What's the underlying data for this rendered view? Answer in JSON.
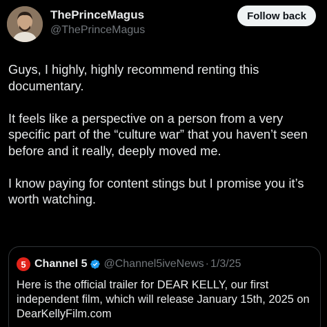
{
  "author": {
    "display_name": "ThePrinceMagus",
    "handle": "@ThePrinceMagus",
    "avatar_icon": "user-avatar"
  },
  "follow_button": {
    "label": "Follow back"
  },
  "post": {
    "paragraphs": [
      "Guys, I highly, highly recommend renting this documentary.",
      "It feels like a perspective on a person from a very specific part of the “culture war” that you haven’t seen before and it really, deeply moved me.",
      "I know paying for content stings but I promise you it’s worth watching."
    ]
  },
  "quote": {
    "logo_text": "5",
    "logo_color": "#e2231a",
    "display_name": "Channel 5",
    "verified_color": "#1d9bf0",
    "handle": "@Channel5iveNews",
    "separator": "·",
    "date": "1/3/25",
    "text": "Here is the official trailer for DEAR KELLY, our first independent film, which will release January 15th, 2025 on DearKellyFilm.com"
  },
  "colors": {
    "background": "#000000",
    "text_primary": "#e7e9ea",
    "text_secondary": "#71767b",
    "border": "#2f3336",
    "button_bg": "#eff3f4"
  }
}
